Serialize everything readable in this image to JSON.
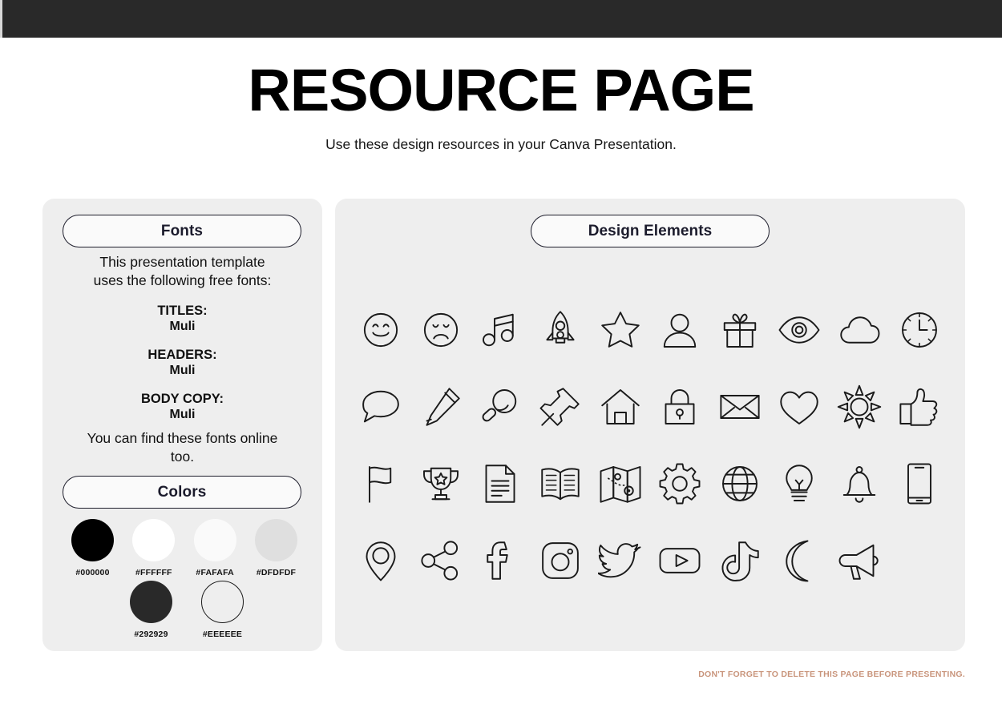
{
  "header": {
    "bar_color": "#292929",
    "title": "RESOURCE PAGE",
    "subtitle": "Use these design resources in your Canva Presentation."
  },
  "fonts_panel": {
    "pill_label": "Fonts",
    "intro_line_1": "This presentation template",
    "intro_line_2": "uses the following free fonts:",
    "titles_label": "TITLES:",
    "titles_font": "Muli",
    "headers_label": "HEADERS:",
    "headers_font": "Muli",
    "body_label": "BODY COPY:",
    "body_font": "Muli",
    "outro_line_1": "You can find these fonts online",
    "outro_line_2": "too."
  },
  "colors_panel": {
    "pill_label": "Colors",
    "row_1": [
      {
        "hex": "#000000",
        "label": "#000000",
        "outlined": false
      },
      {
        "hex": "#FFFFFF",
        "label": "#FFFFFF",
        "outlined": false
      },
      {
        "hex": "#FAFAFA",
        "label": "#FAFAFA",
        "outlined": false
      },
      {
        "hex": "#DFDFDF",
        "label": "#DFDFDF",
        "outlined": false
      }
    ],
    "row_2": [
      {
        "hex": "#292929",
        "label": "#292929",
        "outlined": false
      },
      {
        "hex": "#EEEEEE",
        "label": "#EEEEEE",
        "outlined": true
      }
    ]
  },
  "elements_panel": {
    "pill_label": "Design Elements",
    "icons": [
      "smiley-face-icon",
      "sad-face-icon",
      "music-note-icon",
      "rocket-icon",
      "star-icon",
      "person-icon",
      "gift-icon",
      "eye-icon",
      "cloud-icon",
      "clock-icon",
      "speech-bubble-icon",
      "pencil-icon",
      "magnifier-icon",
      "pushpin-icon",
      "house-icon",
      "lock-icon",
      "envelope-icon",
      "heart-icon",
      "sun-icon",
      "thumbs-up-icon",
      "flag-icon",
      "trophy-icon",
      "document-icon",
      "open-book-icon",
      "map-icon",
      "gear-icon",
      "globe-icon",
      "lightbulb-icon",
      "bell-icon",
      "smartphone-icon",
      "location-pin-icon",
      "share-icon",
      "facebook-icon",
      "instagram-icon",
      "twitter-icon",
      "youtube-icon",
      "tiktok-icon",
      "moon-icon",
      "megaphone-icon"
    ]
  },
  "footer": {
    "note": "DON'T FORGET TO DELETE THIS PAGE BEFORE PRESENTING.",
    "note_color": "#c9957c"
  }
}
